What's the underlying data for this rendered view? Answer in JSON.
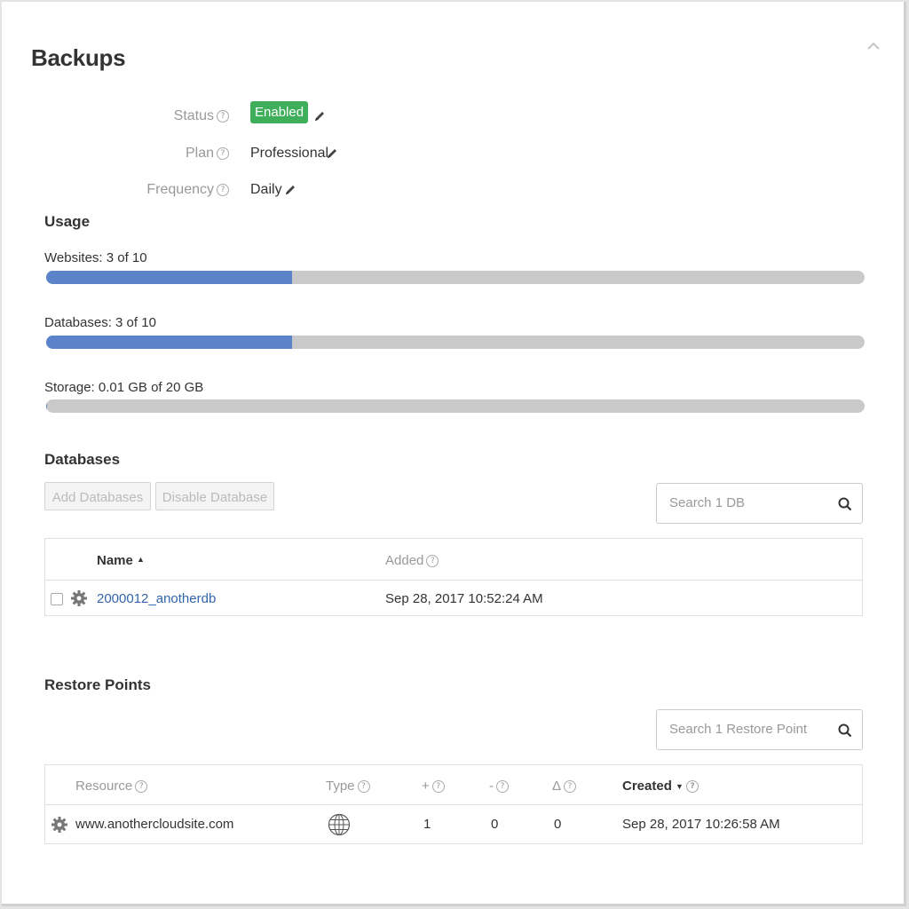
{
  "header": {
    "title": "Backups",
    "collapse_icon": "chevron-up-icon"
  },
  "info": {
    "status": {
      "label": "Status",
      "value": "Enabled",
      "badge_color": "#3fae5a"
    },
    "plan": {
      "label": "Plan",
      "value": "Professional"
    },
    "frequency": {
      "label": "Frequency",
      "value": "Daily"
    },
    "help_glyph": "?"
  },
  "usage": {
    "title": "Usage",
    "websites": {
      "label": "Websites: 3 of 10",
      "fraction": 0.3
    },
    "databases": {
      "label": "Databases: 3 of 10",
      "fraction": 0.3
    },
    "storage": {
      "label": "Storage: 0.01 GB of 20 GB",
      "fraction": 0.0005
    },
    "fill_color": "#5b83c9"
  },
  "databases": {
    "title": "Databases",
    "add_button": "Add Databases",
    "disable_button": "Disable Database",
    "search_placeholder": "Search 1 DB",
    "columns": {
      "name": "Name",
      "added": "Added"
    },
    "rows": [
      {
        "name": "2000012_anotherdb",
        "added": "Sep 28, 2017 10:52:24 AM"
      }
    ]
  },
  "restore_points": {
    "title": "Restore Points",
    "search_placeholder": "Search 1 Restore Point",
    "columns": {
      "resource": "Resource",
      "type": "Type",
      "plus": "+",
      "minus": "-",
      "delta": "Δ",
      "created": "Created"
    },
    "rows": [
      {
        "resource": "www.anothercloudsite.com",
        "type_icon": "globe-icon",
        "plus": "1",
        "minus": "0",
        "delta": "0",
        "created": "Sep 28, 2017 10:26:58 AM"
      }
    ]
  }
}
